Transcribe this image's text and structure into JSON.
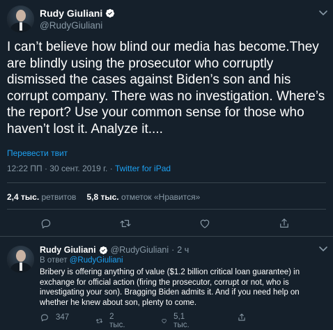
{
  "main_tweet": {
    "name": "Rudy Giuliani",
    "handle": "@RudyGiuliani",
    "text": "I can’t believe how blind our media has become.They are blindly using the prosecutor who corruptly dismissed the cases against Biden’s son and his corrupt company. There was no investigation. Where’s the report? Use your common sense for those who haven’t lost it. Analyze it....",
    "translate_label": "Перевести твит",
    "timestamp": "12:22 ПП · 30 сент. 2019 г. · ",
    "source": "Twitter for iPad",
    "retweets_count": "2,4 тыс.",
    "retweets_label": "ретвитов",
    "likes_count": "5,8 тыс.",
    "likes_label": "отметок «Нравится»"
  },
  "reply_tweet": {
    "name": "Rudy Giuliani",
    "handle": "@RudyGiuliani",
    "separator": "·",
    "time": "2 ч",
    "in_reply_prefix": "В ответ ",
    "in_reply_handle": "@RudyGiuliani",
    "text": "Bribery is offering anything of value ($1.2 billion critical loan guarantee) in exchange for official action (firing the prosecutor, corrupt or not, who is investigating your son). Bragging Biden admits it. And if you need help on whether he knew about son, plenty to come.",
    "replies_count": "347",
    "retweets_count": "2 тыс.",
    "likes_count": "5,1 тыс."
  },
  "colors": {
    "background": "#15202b",
    "accent": "#1da1f2",
    "muted": "#8899a6",
    "border": "#38444d"
  },
  "icons": [
    "verified-badge-icon",
    "chevron-down-icon",
    "reply-icon",
    "retweet-icon",
    "like-icon",
    "share-icon"
  ]
}
